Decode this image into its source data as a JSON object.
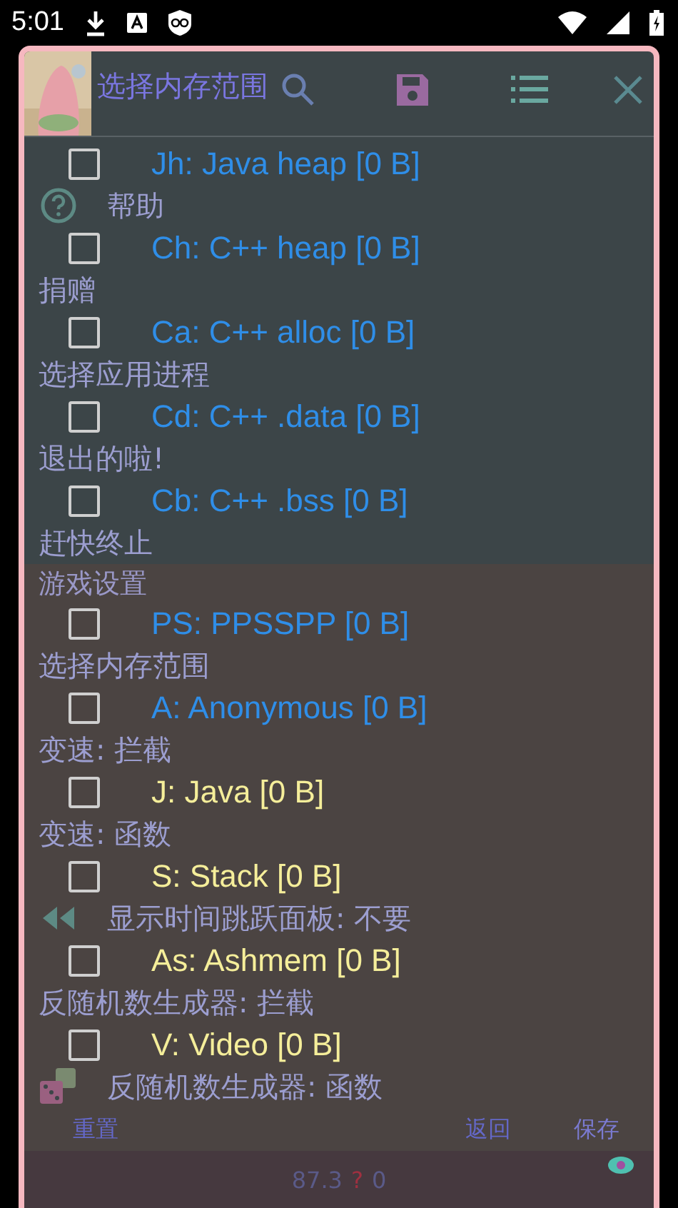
{
  "status_bar": {
    "time": "5:01"
  },
  "dialog": {
    "title": "选择内存范围"
  },
  "background_menu": [
    {
      "kind": "help",
      "label": "帮助"
    },
    {
      "kind": "plain",
      "label": "捐赠"
    },
    {
      "kind": "plain",
      "label": "选择应用进程"
    },
    {
      "kind": "plain",
      "label": "退出的啦!"
    },
    {
      "kind": "plain",
      "label": "赶快终止"
    },
    {
      "kind": "section",
      "label": "游戏设置"
    },
    {
      "kind": "plain",
      "label": "选择内存范围"
    },
    {
      "kind": "plain",
      "label": "变速: 拦截"
    },
    {
      "kind": "plain",
      "label": "变速: 函数"
    },
    {
      "kind": "rewind",
      "label": "显示时间跳跃面板: 不要"
    },
    {
      "kind": "plain",
      "label": "反随机数生成器: 拦截"
    },
    {
      "kind": "dice",
      "label": "反随机数生成器: 函数"
    }
  ],
  "regions": [
    {
      "label": "Jh: Java heap [0 B]",
      "checked": false,
      "color": "#2f8ee8"
    },
    {
      "label": "Ch: C++ heap [0 B]",
      "checked": false,
      "color": "#2f8ee8"
    },
    {
      "label": "Ca: C++ alloc [0 B]",
      "checked": false,
      "color": "#2f8ee8"
    },
    {
      "label": "Cd: C++ .data [0 B]",
      "checked": false,
      "color": "#2f8ee8"
    },
    {
      "label": "Cb: C++ .bss [0 B]",
      "checked": false,
      "color": "#2f8ee8"
    },
    {
      "label": "PS: PPSSPP [0 B]",
      "checked": false,
      "color": "#2f8ee8"
    },
    {
      "label": "A: Anonymous [0 B]",
      "checked": false,
      "color": "#2f8ee8"
    },
    {
      "label": "J: Java [0 B]",
      "checked": false,
      "color": "#f5ee9a"
    },
    {
      "label": "S: Stack [0 B]",
      "checked": false,
      "color": "#f5ee9a"
    },
    {
      "label": "As: Ashmem [0 B]",
      "checked": false,
      "color": "#f5ee9a"
    },
    {
      "label": "V: Video [0 B]",
      "checked": false,
      "color": "#f5ee9a"
    }
  ],
  "buttons": [
    {
      "label": "重置"
    },
    {
      "label": "返回"
    },
    {
      "label": "保存"
    }
  ],
  "footer": {
    "value_1": "87.3",
    "mark": "?",
    "value_2": "0"
  }
}
